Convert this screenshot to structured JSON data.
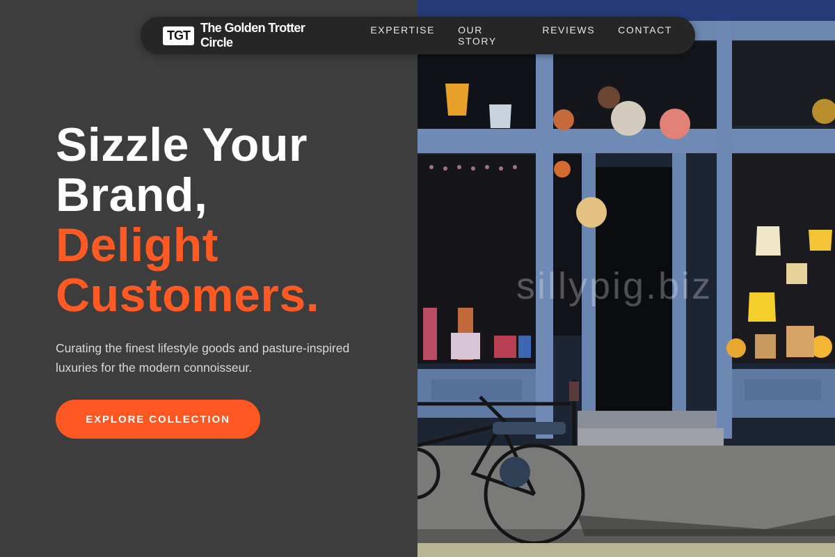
{
  "brand": {
    "badge": "TGT",
    "name": "The Golden Trotter Circle"
  },
  "nav": {
    "items": [
      "EXPERTISE",
      "OUR STORY",
      "REVIEWS",
      "CONTACT"
    ]
  },
  "hero": {
    "line1": "Sizzle Your",
    "line2": "Brand,",
    "line3": "Delight",
    "line4": "Customers.",
    "subtitle": "Curating the finest lifestyle goods and pasture-inspired luxuries for the modern connoisseur.",
    "cta_label": "EXPLORE COLLECTION"
  },
  "photo": {
    "watermark": "sillypig.biz"
  },
  "colors": {
    "accent": "#ff5722",
    "background": "#3d3d3d",
    "navbar": "#262626"
  }
}
